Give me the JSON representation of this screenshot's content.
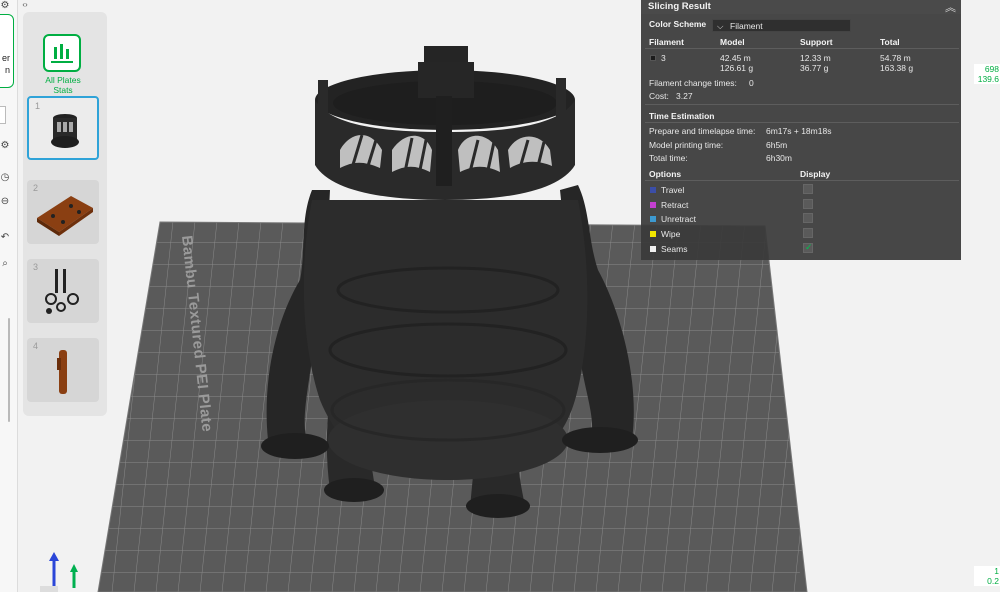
{
  "app": {
    "partial_sidebar_labels": [
      "er",
      "n"
    ]
  },
  "plates": {
    "all_plates_label_line1": "All Plates",
    "all_plates_label_line2": "Stats",
    "items": [
      {
        "number": "1"
      },
      {
        "number": "2"
      },
      {
        "number": "3"
      },
      {
        "number": "4"
      }
    ]
  },
  "viewport": {
    "bed_label": "Bambu Textured PEI Plate",
    "coord_top_1": "698",
    "coord_top_2": "139.6",
    "coord_bottom_1": "1",
    "coord_bottom_2": "0.2"
  },
  "slicing_result": {
    "title": "Slicing Result",
    "color_scheme_label": "Color Scheme",
    "color_scheme_value": "Filament",
    "headers": {
      "filament": "Filament",
      "model": "Model",
      "support": "Support",
      "total": "Total"
    },
    "rows": [
      {
        "filament": "3",
        "model_length": "42.45 m",
        "model_weight": "126.61 g",
        "support_length": "12.33 m",
        "support_weight": "36.77 g",
        "total_length": "54.78 m",
        "total_weight": "163.38 g"
      }
    ],
    "filament_change_label": "Filament change times:",
    "filament_change_value": "0",
    "cost_label": "Cost:",
    "cost_value": "3.27",
    "time_estimation_title": "Time Estimation",
    "prepare_label": "Prepare and timelapse time:",
    "prepare_value": "6m17s + 18m18s",
    "model_time_label": "Model printing time:",
    "model_time_value": "6h5m",
    "total_time_label": "Total time:",
    "total_time_value": "6h30m",
    "options_label": "Options",
    "display_label": "Display",
    "options": [
      {
        "name": "Travel",
        "color": "#3b4ea8",
        "checked": false
      },
      {
        "name": "Retract",
        "color": "#c43fd1",
        "checked": false
      },
      {
        "name": "Unretract",
        "color": "#3d9ad1",
        "checked": false
      },
      {
        "name": "Wipe",
        "color": "#f2e600",
        "checked": false
      },
      {
        "name": "Seams",
        "color": "#f0f0f0",
        "checked": true
      }
    ]
  },
  "colors": {
    "accent": "#00ae42",
    "selection": "#2fa3d8",
    "panel_bg": "#3a3a3a",
    "plate": "#5a5a5a",
    "model": "#2a2a2a"
  }
}
